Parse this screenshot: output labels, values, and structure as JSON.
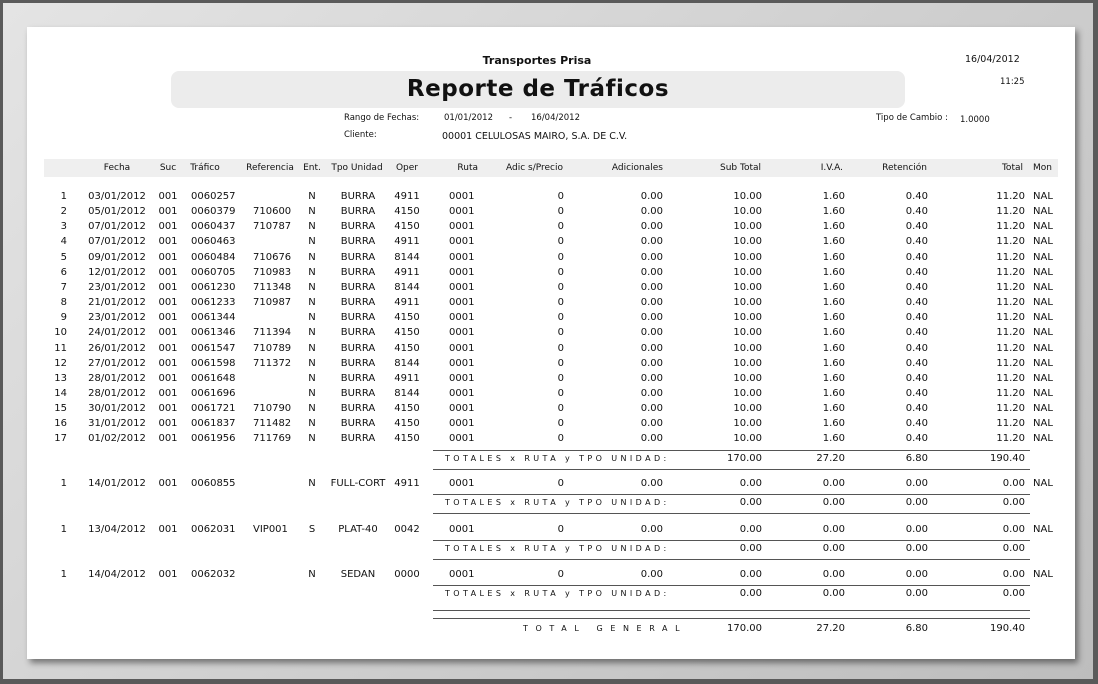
{
  "report": {
    "company": "Transportes Prisa",
    "title": "Reporte de Tráficos",
    "date": "16/04/2012",
    "time": "11:25",
    "range_label": "Rango de Fechas:",
    "range_from": "01/01/2012",
    "range_sep": "-",
    "range_to": "16/04/2012",
    "client_label": "Cliente:",
    "client_value": "00001   CELULOSAS MAIRO, S.A. DE C.V.",
    "exchange_label": "Tipo de Cambio :",
    "exchange_value": "1.0000"
  },
  "columns": [
    "Fecha",
    "Suc",
    "Tráfico",
    "Referencia",
    "Ent.",
    "Tpo Unidad",
    "Oper",
    "Ruta",
    "Adic s/Precio",
    "Adicionales",
    "Sub Total",
    "I.V.A.",
    "Retención",
    "Total",
    "Mon"
  ],
  "groups": [
    {
      "rows": [
        [
          "1",
          "03/01/2012",
          "001",
          "0060257",
          "",
          "N",
          "BURRA",
          "4911",
          "0001",
          "0",
          "0.00",
          "10.00",
          "1.60",
          "0.40",
          "11.20",
          "NAL"
        ],
        [
          "2",
          "05/01/2012",
          "001",
          "0060379",
          "710600",
          "N",
          "BURRA",
          "4150",
          "0001",
          "0",
          "0.00",
          "10.00",
          "1.60",
          "0.40",
          "11.20",
          "NAL"
        ],
        [
          "3",
          "07/01/2012",
          "001",
          "0060437",
          "710787",
          "N",
          "BURRA",
          "4150",
          "0001",
          "0",
          "0.00",
          "10.00",
          "1.60",
          "0.40",
          "11.20",
          "NAL"
        ],
        [
          "4",
          "07/01/2012",
          "001",
          "0060463",
          "",
          "N",
          "BURRA",
          "4911",
          "0001",
          "0",
          "0.00",
          "10.00",
          "1.60",
          "0.40",
          "11.20",
          "NAL"
        ],
        [
          "5",
          "09/01/2012",
          "001",
          "0060484",
          "710676",
          "N",
          "BURRA",
          "8144",
          "0001",
          "0",
          "0.00",
          "10.00",
          "1.60",
          "0.40",
          "11.20",
          "NAL"
        ],
        [
          "6",
          "12/01/2012",
          "001",
          "0060705",
          "710983",
          "N",
          "BURRA",
          "4911",
          "0001",
          "0",
          "0.00",
          "10.00",
          "1.60",
          "0.40",
          "11.20",
          "NAL"
        ],
        [
          "7",
          "23/01/2012",
          "001",
          "0061230",
          "711348",
          "N",
          "BURRA",
          "8144",
          "0001",
          "0",
          "0.00",
          "10.00",
          "1.60",
          "0.40",
          "11.20",
          "NAL"
        ],
        [
          "8",
          "21/01/2012",
          "001",
          "0061233",
          "710987",
          "N",
          "BURRA",
          "4911",
          "0001",
          "0",
          "0.00",
          "10.00",
          "1.60",
          "0.40",
          "11.20",
          "NAL"
        ],
        [
          "9",
          "23/01/2012",
          "001",
          "0061344",
          "",
          "N",
          "BURRA",
          "4150",
          "0001",
          "0",
          "0.00",
          "10.00",
          "1.60",
          "0.40",
          "11.20",
          "NAL"
        ],
        [
          "10",
          "24/01/2012",
          "001",
          "0061346",
          "711394",
          "N",
          "BURRA",
          "4150",
          "0001",
          "0",
          "0.00",
          "10.00",
          "1.60",
          "0.40",
          "11.20",
          "NAL"
        ],
        [
          "11",
          "26/01/2012",
          "001",
          "0061547",
          "710789",
          "N",
          "BURRA",
          "4150",
          "0001",
          "0",
          "0.00",
          "10.00",
          "1.60",
          "0.40",
          "11.20",
          "NAL"
        ],
        [
          "12",
          "27/01/2012",
          "001",
          "0061598",
          "711372",
          "N",
          "BURRA",
          "8144",
          "0001",
          "0",
          "0.00",
          "10.00",
          "1.60",
          "0.40",
          "11.20",
          "NAL"
        ],
        [
          "13",
          "28/01/2012",
          "001",
          "0061648",
          "",
          "N",
          "BURRA",
          "4911",
          "0001",
          "0",
          "0.00",
          "10.00",
          "1.60",
          "0.40",
          "11.20",
          "NAL"
        ],
        [
          "14",
          "28/01/2012",
          "001",
          "0061696",
          "",
          "N",
          "BURRA",
          "8144",
          "0001",
          "0",
          "0.00",
          "10.00",
          "1.60",
          "0.40",
          "11.20",
          "NAL"
        ],
        [
          "15",
          "30/01/2012",
          "001",
          "0061721",
          "710790",
          "N",
          "BURRA",
          "4150",
          "0001",
          "0",
          "0.00",
          "10.00",
          "1.60",
          "0.40",
          "11.20",
          "NAL"
        ],
        [
          "16",
          "31/01/2012",
          "001",
          "0061837",
          "711482",
          "N",
          "BURRA",
          "4150",
          "0001",
          "0",
          "0.00",
          "10.00",
          "1.60",
          "0.40",
          "11.20",
          "NAL"
        ],
        [
          "17",
          "01/02/2012",
          "001",
          "0061956",
          "711769",
          "N",
          "BURRA",
          "4150",
          "0001",
          "0",
          "0.00",
          "10.00",
          "1.60",
          "0.40",
          "11.20",
          "NAL"
        ]
      ],
      "subtotal": {
        "label": "TOTALES x RUTA y TPO UNIDAD:",
        "subtotal": "170.00",
        "iva": "27.20",
        "retencion": "6.80",
        "total": "190.40"
      }
    },
    {
      "rows": [
        [
          "1",
          "14/01/2012",
          "001",
          "0060855",
          "",
          "N",
          "FULL-CORT",
          "4911",
          "0001",
          "0",
          "0.00",
          "0.00",
          "0.00",
          "0.00",
          "0.00",
          "NAL"
        ]
      ],
      "subtotal": {
        "label": "TOTALES x RUTA y TPO UNIDAD:",
        "subtotal": "0.00",
        "iva": "0.00",
        "retencion": "0.00",
        "total": "0.00"
      }
    },
    {
      "rows": [
        [
          "1",
          "13/04/2012",
          "001",
          "0062031",
          "VIP001",
          "S",
          "PLAT-40",
          "0042",
          "0001",
          "0",
          "0.00",
          "0.00",
          "0.00",
          "0.00",
          "0.00",
          "NAL"
        ]
      ],
      "subtotal": {
        "label": "TOTALES x RUTA y TPO UNIDAD:",
        "subtotal": "0.00",
        "iva": "0.00",
        "retencion": "0.00",
        "total": "0.00"
      }
    },
    {
      "rows": [
        [
          "1",
          "14/04/2012",
          "001",
          "0062032",
          "",
          "N",
          "SEDAN",
          "0000",
          "0001",
          "0",
          "0.00",
          "0.00",
          "0.00",
          "0.00",
          "0.00",
          "NAL"
        ]
      ],
      "subtotal": {
        "label": "TOTALES x RUTA y TPO UNIDAD:",
        "subtotal": "0.00",
        "iva": "0.00",
        "retencion": "0.00",
        "total": "0.00"
      }
    }
  ],
  "grand_total": {
    "label": "TOTAL GENERAL",
    "subtotal": "170.00",
    "iva": "27.20",
    "retencion": "6.80",
    "total": "190.40"
  }
}
